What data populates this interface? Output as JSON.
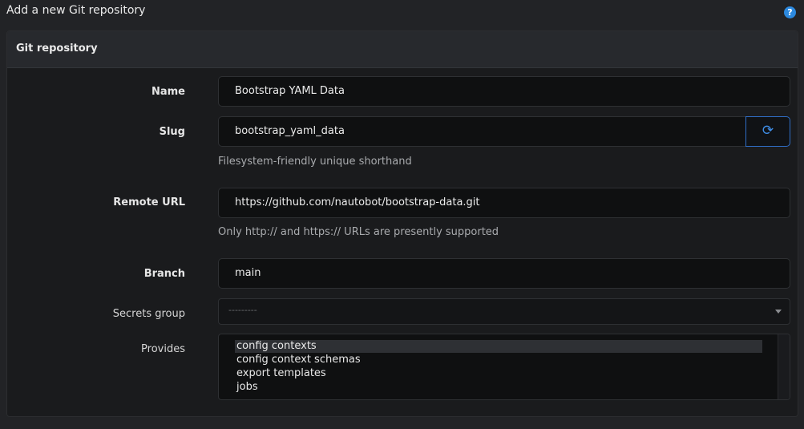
{
  "header": {
    "title": "Add a new Git repository",
    "help_icon": "question-circle-icon",
    "help_glyph": "?"
  },
  "panel": {
    "title": "Git repository"
  },
  "form": {
    "name": {
      "label": "Name",
      "value": "Bootstrap YAML Data"
    },
    "slug": {
      "label": "Slug",
      "value": "bootstrap_yaml_data",
      "help": "Filesystem-friendly unique shorthand",
      "regenerate_icon": "refresh-icon",
      "regenerate_glyph": "⟳"
    },
    "remote_url": {
      "label": "Remote URL",
      "value": "https://github.com/nautobot/bootstrap-data.git",
      "help": "Only http:// and https:// URLs are presently supported"
    },
    "branch": {
      "label": "Branch",
      "value": "main"
    },
    "secrets_group": {
      "label": "Secrets group",
      "placeholder": "---------"
    },
    "provides": {
      "label": "Provides",
      "options": [
        {
          "label": "config contexts",
          "selected": true
        },
        {
          "label": "config context schemas",
          "selected": false
        },
        {
          "label": "export templates",
          "selected": false
        },
        {
          "label": "jobs",
          "selected": false
        }
      ]
    }
  },
  "colors": {
    "accent": "#2c89df",
    "background": "#222326",
    "panel": "#1a1b1d",
    "input": "#0f1011"
  }
}
